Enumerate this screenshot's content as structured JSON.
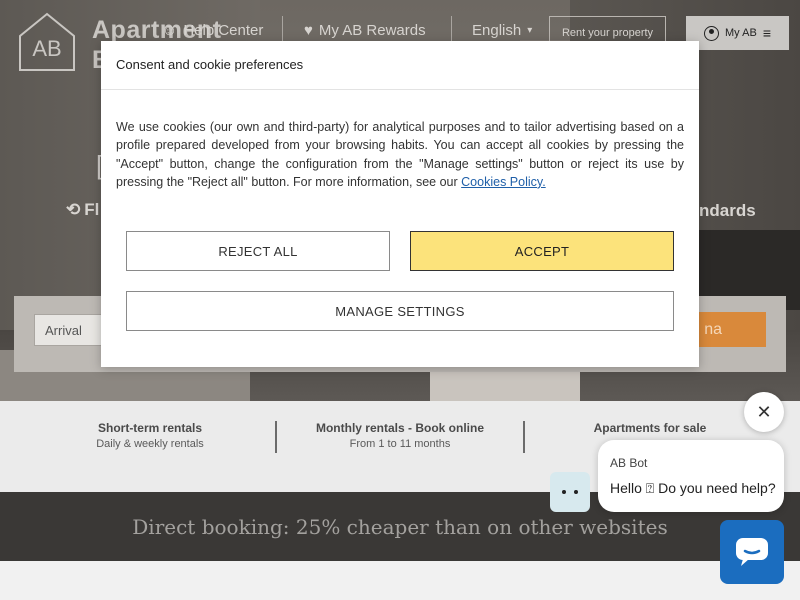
{
  "header": {
    "brand_line1": "Apartment",
    "brand_line2": "B",
    "help_center": "Help Center",
    "rewards": "My AB Rewards",
    "language": "English",
    "rent_property": "Rent your property",
    "my_ab": "My AB"
  },
  "hero": {
    "left_tagline": "Fl",
    "right_tagline": "ndards",
    "arrival_placeholder": "Arrival",
    "search_label": "na"
  },
  "categories": [
    {
      "title": "Short-term rentals",
      "subtitle": "Daily & weekly rentals"
    },
    {
      "title": "Monthly rentals - Book online",
      "subtitle": "From 1 to 11 months"
    },
    {
      "title": "Apartments for sale",
      "subtitle": ""
    }
  ],
  "band": {
    "text": "Direct booking: 25% cheaper than on other websites"
  },
  "consent": {
    "title": "Consent and cookie preferences",
    "body": "We use cookies (our own and third-party) for analytical purposes and to tailor advertising based on a profile prepared developed from your browsing habits. You can accept all cookies by pressing the \"Accept\" button, change the configuration from the \"Manage settings\" button or reject its use by pressing the \"Reject all\" button. For more information, see our ",
    "link": "Cookies Policy.",
    "reject_label": "REJECT ALL",
    "accept_label": "ACCEPT",
    "manage_label": "MANAGE SETTINGS"
  },
  "chat": {
    "bot_name": "AB Bot",
    "message": "Hello ⍰ Do you need help?",
    "close_icon": "close-icon"
  },
  "colors": {
    "accept": "#fce37b",
    "link": "#1f5fa8",
    "band": "#3a3836",
    "chat_launcher": "#1b6dbf",
    "search_button": "#d9893b"
  }
}
